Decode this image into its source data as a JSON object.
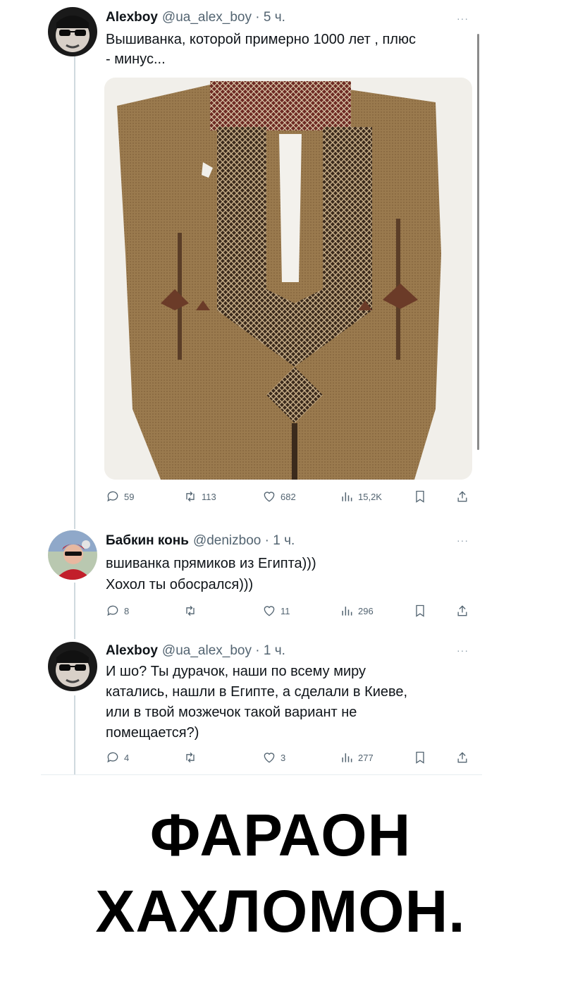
{
  "tweets": [
    {
      "name": "Alexboy",
      "meta": "@ua_alex_boy · 5 ч.",
      "more": "···",
      "lines": [
        "Вышиванка, которой примерно 1000 лет , плюс",
        "- минус..."
      ],
      "image": "embroidered-shirt-photo",
      "stats": {
        "replies": "59",
        "reposts": "113",
        "likes": "682",
        "views": "15,2K"
      }
    },
    {
      "name": "Бабкин конь",
      "meta": "@denizboo · 1 ч.",
      "more": "···",
      "lines": [
        "вшиванка прямиков из Египта)))",
        "Хохол ты обосрался)))"
      ],
      "stats": {
        "replies": "8",
        "reposts": "",
        "likes": "11",
        "views": "296"
      }
    },
    {
      "name": "Alexboy",
      "meta": "@ua_alex_boy · 1 ч.",
      "more": "···",
      "lines": [
        "И шо? Ты дурачок, наши по всему миру",
        "катались, нашли в Египте, а сделали в Киеве,",
        "или в твой мозжечок такой вариант не",
        "помещается?)"
      ],
      "stats": {
        "replies": "4",
        "reposts": "",
        "likes": "3",
        "views": "277"
      }
    }
  ],
  "caption": {
    "line1": "ФАРАОН",
    "line2": "ХАХЛОМОН."
  },
  "colors": {
    "text": "#0f1419",
    "muted": "#536471",
    "thread": "#cfd9de",
    "fabric": "#9a7a4e",
    "embroidery": "#3b2a1c",
    "accent_red": "#9c2f2a"
  },
  "icons": [
    "reply-icon",
    "repost-icon",
    "like-icon",
    "views-icon",
    "bookmark-icon",
    "share-icon"
  ]
}
